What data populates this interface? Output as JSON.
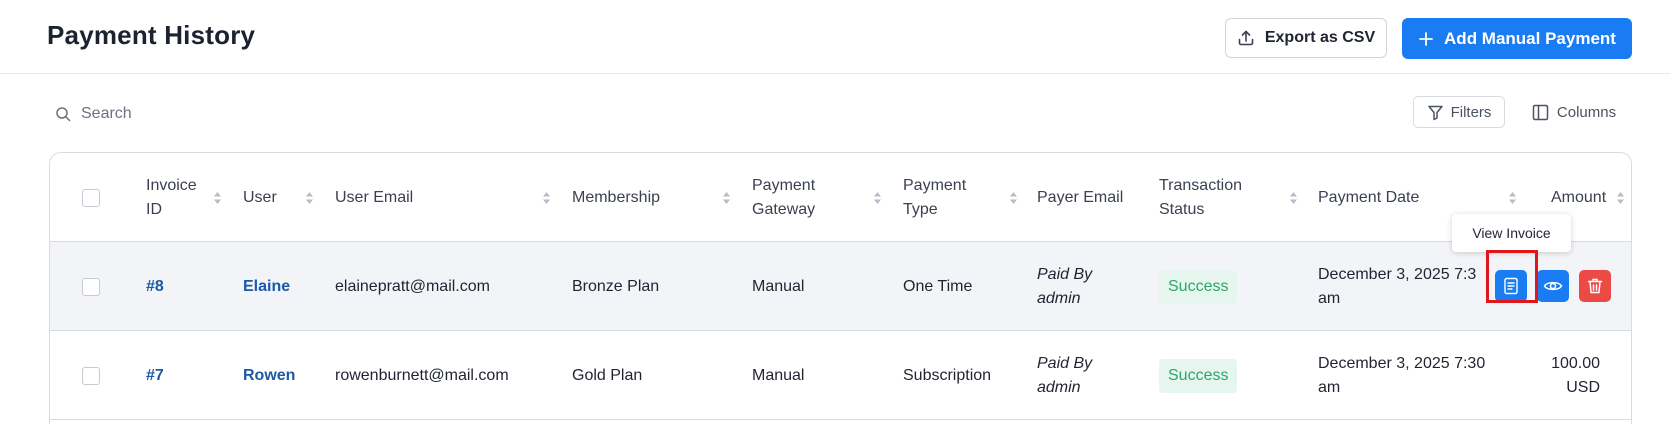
{
  "header": {
    "title": "Payment History",
    "export_label": "Export as CSV",
    "add_label": "Add Manual Payment"
  },
  "toolbar": {
    "search_placeholder": "Search",
    "filters_label": "Filters",
    "columns_label": "Columns"
  },
  "table": {
    "columns": [
      {
        "key": "invoice_id",
        "line1": "Invoice",
        "line2": "ID"
      },
      {
        "key": "user",
        "line1": "User",
        "line2": ""
      },
      {
        "key": "user_email",
        "line1": "User Email",
        "line2": ""
      },
      {
        "key": "membership",
        "line1": "Membership",
        "line2": ""
      },
      {
        "key": "payment_gateway",
        "line1": "Payment",
        "line2": "Gateway"
      },
      {
        "key": "payment_type",
        "line1": "Payment",
        "line2": "Type"
      },
      {
        "key": "payer_email",
        "line1": "Payer Email",
        "line2": ""
      },
      {
        "key": "transaction_status",
        "line1": "Transaction",
        "line2": "Status"
      },
      {
        "key": "payment_date",
        "line1": "Payment Date",
        "line2": ""
      },
      {
        "key": "amount",
        "line1": "Amount",
        "line2": ""
      }
    ],
    "rows": [
      {
        "invoice_id": "#8",
        "user": "Elaine",
        "user_email": "elainepratt@mail.com",
        "membership": "Bronze Plan",
        "payment_gateway": "Manual",
        "payment_type": "One Time",
        "payer_line1": "Paid By",
        "payer_line2": "admin",
        "status": "Success",
        "date_line1": "December 3, 2025 7:3",
        "date_line2": "am",
        "amount_line1": "",
        "amount_line2": ""
      },
      {
        "invoice_id": "#7",
        "user": "Rowen",
        "user_email": "rowenburnett@mail.com",
        "membership": "Gold Plan",
        "payment_gateway": "Manual",
        "payment_type": "Subscription",
        "payer_line1": "Paid By",
        "payer_line2": "admin",
        "status": "Success",
        "date_line1": "December 3, 2025 7:30",
        "date_line2": "am",
        "amount_line1": "100.00",
        "amount_line2": "USD"
      }
    ]
  },
  "tooltip": {
    "text": "View Invoice"
  },
  "icons": {
    "export": "upload-icon",
    "add": "plus-icon",
    "search": "search-icon",
    "filters": "filter-icon",
    "columns": "columns-icon",
    "sort": "sort-arrows-icon",
    "view_invoice": "document-icon",
    "view": "eye-icon",
    "delete": "trash-icon"
  },
  "colors": {
    "primary": "#1a7cf2",
    "danger": "#ec4a45",
    "success_text": "#2ea56a",
    "success_bg": "#e6f6ee",
    "link": "#1b5aa8",
    "highlight": "#e0161b"
  }
}
